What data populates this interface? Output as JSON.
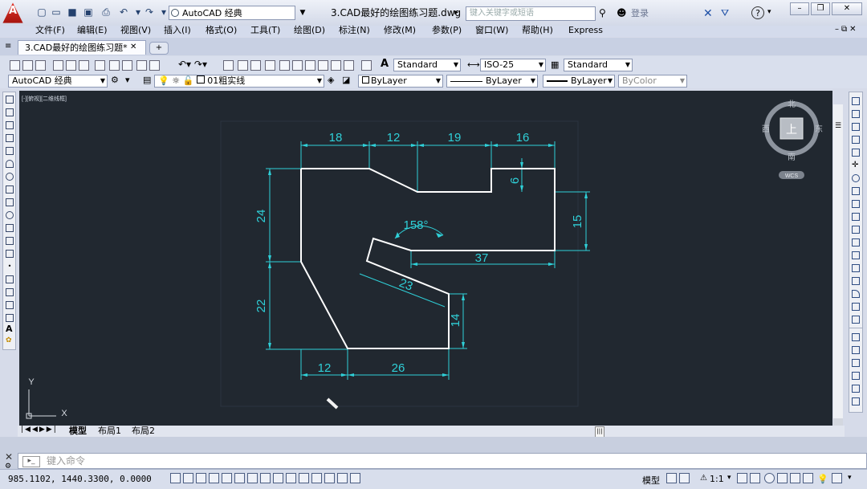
{
  "app": {
    "workspace": "AutoCAD 经典",
    "document_title": "3.CAD最好的绘图练习题.dwg",
    "search_placeholder": "键入关键字或短语",
    "login": "登录"
  },
  "menu": [
    "文件(F)",
    "编辑(E)",
    "视图(V)",
    "插入(I)",
    "格式(O)",
    "工具(T)",
    "绘图(D)",
    "标注(N)",
    "修改(M)",
    "参数(P)",
    "窗口(W)",
    "帮助(H)",
    "Express"
  ],
  "tabs": {
    "document": "3.CAD最好的绘图练习题*"
  },
  "toolbar1": {
    "text_style": "Standard",
    "dim_style": "ISO-25",
    "table_style": "Standard"
  },
  "toolbar2": {
    "workspace": "AutoCAD 经典",
    "layer": "01粗实线",
    "color": "ByLayer",
    "linetype": "ByLayer",
    "lineweight": "ByLayer",
    "plotstyle": "ByColor"
  },
  "viewport": {
    "label": "[-][俯视][二维线框]"
  },
  "viewcube": {
    "north": "北",
    "south": "南",
    "east": "东",
    "west": "西",
    "top": "上",
    "wcs": "WCS"
  },
  "ucs": {
    "x": "X",
    "y": "Y"
  },
  "dimensions": {
    "top_18": "18",
    "top_12": "12",
    "top_19": "19",
    "top_16": "16",
    "notch_6": "6",
    "right_15": "15",
    "angle": "158°",
    "inner_37": "37",
    "slant_23": "23",
    "left_24": "24",
    "left_22": "22",
    "right_14": "14",
    "bottom_12": "12",
    "bottom_26": "26"
  },
  "layout_tabs": [
    "模型",
    "布局1",
    "布局2"
  ],
  "command": {
    "prompt": "键入命令"
  },
  "status": {
    "coords": "985.1102,  1440.3300, 0.0000",
    "model": "模型",
    "scale": "1:1"
  },
  "colors": {
    "canvas": "#212830",
    "geometry": "#ffffff",
    "dimension": "#2fd0d8"
  }
}
